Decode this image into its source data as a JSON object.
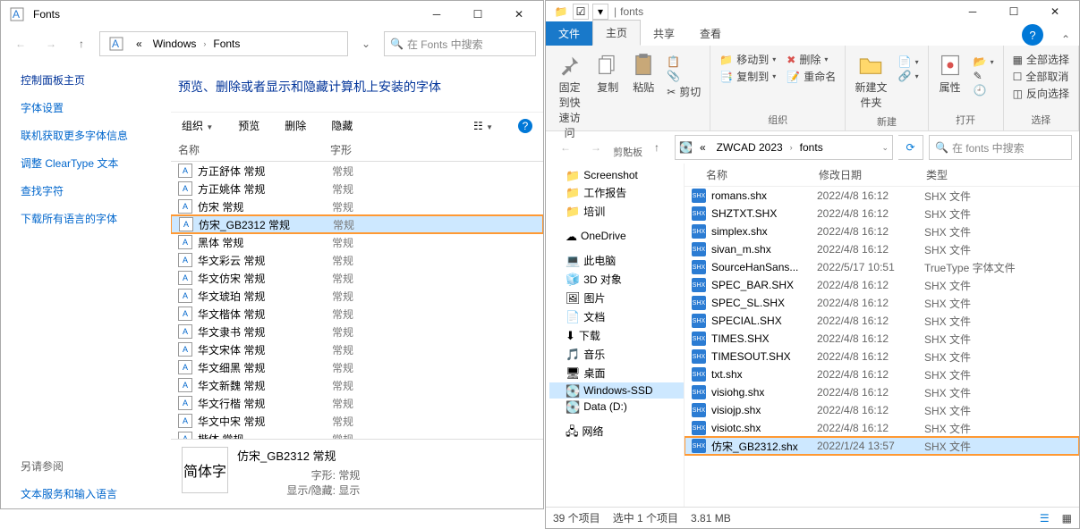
{
  "left": {
    "title": "Fonts",
    "breadcrumbs": [
      "Windows",
      "Fonts"
    ],
    "search_placeholder": "在 Fonts 中搜索",
    "sidebar": {
      "header": "控制面板主页",
      "links": [
        "字体设置",
        "联机获取更多字体信息",
        "调整 ClearType 文本",
        "查找字符",
        "下载所有语言的字体"
      ],
      "see_also": "另请参阅",
      "see_link": "文本服务和输入语言"
    },
    "header_text": "预览、删除或者显示和隐藏计算机上安装的字体",
    "toolbar": {
      "org": "组织",
      "prev": "预览",
      "del": "删除",
      "hide": "隐藏"
    },
    "cols": {
      "name": "名称",
      "style": "字形"
    },
    "items": [
      {
        "n": "方正舒体 常规",
        "s": "常规"
      },
      {
        "n": "方正姚体 常规",
        "s": "常规"
      },
      {
        "n": "仿宋 常规",
        "s": "常规"
      },
      {
        "n": "仿宋_GB2312 常规",
        "s": "常规",
        "sel": true,
        "frame": true
      },
      {
        "n": "黑体 常规",
        "s": "常规"
      },
      {
        "n": "华文彩云 常规",
        "s": "常规"
      },
      {
        "n": "华文仿宋 常规",
        "s": "常规"
      },
      {
        "n": "华文琥珀 常规",
        "s": "常规"
      },
      {
        "n": "华文楷体 常规",
        "s": "常规"
      },
      {
        "n": "华文隶书 常规",
        "s": "常规"
      },
      {
        "n": "华文宋体 常规",
        "s": "常规"
      },
      {
        "n": "华文细黑 常规",
        "s": "常规"
      },
      {
        "n": "华文新魏 常规",
        "s": "常规"
      },
      {
        "n": "华文行楷 常规",
        "s": "常规"
      },
      {
        "n": "华文中宋 常规",
        "s": "常规"
      },
      {
        "n": "楷体 常规",
        "s": "常规"
      }
    ],
    "detail": {
      "name": "仿宋_GB2312 常规",
      "style_label": "字形:",
      "style_val": "常规",
      "show_label": "显示/隐藏:",
      "show_val": "显示",
      "preview": "简体字"
    }
  },
  "right": {
    "title": "fonts",
    "tabs": {
      "file": "文件",
      "home": "主页",
      "share": "共享",
      "view": "查看"
    },
    "ribbon": {
      "pin": "固定到快速访问",
      "copy": "复制",
      "paste": "粘贴",
      "cut": "剪切",
      "clip_grp": "剪贴板",
      "move": "移动到",
      "copyto": "复制到",
      "del": "删除",
      "rename": "重命名",
      "org_grp": "组织",
      "newfolder": "新建文件夹",
      "new_grp": "新建",
      "props": "属性",
      "open_grp": "打开",
      "selall": "全部选择",
      "selnone": "全部取消",
      "selinv": "反向选择",
      "sel_grp": "选择"
    },
    "breadcrumbs": [
      "ZWCAD 2023",
      "fonts"
    ],
    "search_placeholder": "在 fonts 中搜索",
    "tree": [
      {
        "n": "Screenshot",
        "i": "📁"
      },
      {
        "n": "工作报告",
        "i": "📁"
      },
      {
        "n": "培训",
        "i": "📁"
      },
      {
        "n": "OneDrive",
        "i": "☁",
        "gap": true
      },
      {
        "n": "此电脑",
        "i": "💻",
        "gap": true
      },
      {
        "n": "3D 对象",
        "i": "🧊"
      },
      {
        "n": "图片",
        "i": "🖼"
      },
      {
        "n": "文档",
        "i": "📄"
      },
      {
        "n": "下载",
        "i": "⬇"
      },
      {
        "n": "音乐",
        "i": "🎵"
      },
      {
        "n": "桌面",
        "i": "🖥"
      },
      {
        "n": "Windows-SSD",
        "i": "💽",
        "sel": true
      },
      {
        "n": "Data (D:)",
        "i": "💽"
      },
      {
        "n": "网络",
        "i": "🖧",
        "gap": true
      }
    ],
    "cols": {
      "name": "名称",
      "date": "修改日期",
      "type": "类型"
    },
    "files": [
      {
        "n": "romans.shx",
        "d": "2022/4/8 16:12",
        "t": "SHX 文件"
      },
      {
        "n": "SHZTXT.SHX",
        "d": "2022/4/8 16:12",
        "t": "SHX 文件"
      },
      {
        "n": "simplex.shx",
        "d": "2022/4/8 16:12",
        "t": "SHX 文件"
      },
      {
        "n": "sivan_m.shx",
        "d": "2022/4/8 16:12",
        "t": "SHX 文件"
      },
      {
        "n": "SourceHanSans...",
        "d": "2022/5/17 10:51",
        "t": "TrueType 字体文件"
      },
      {
        "n": "SPEC_BAR.SHX",
        "d": "2022/4/8 16:12",
        "t": "SHX 文件"
      },
      {
        "n": "SPEC_SL.SHX",
        "d": "2022/4/8 16:12",
        "t": "SHX 文件"
      },
      {
        "n": "SPECIAL.SHX",
        "d": "2022/4/8 16:12",
        "t": "SHX 文件"
      },
      {
        "n": "TIMES.SHX",
        "d": "2022/4/8 16:12",
        "t": "SHX 文件"
      },
      {
        "n": "TIMESOUT.SHX",
        "d": "2022/4/8 16:12",
        "t": "SHX 文件"
      },
      {
        "n": "txt.shx",
        "d": "2022/4/8 16:12",
        "t": "SHX 文件"
      },
      {
        "n": "visiohg.shx",
        "d": "2022/4/8 16:12",
        "t": "SHX 文件"
      },
      {
        "n": "visiojp.shx",
        "d": "2022/4/8 16:12",
        "t": "SHX 文件"
      },
      {
        "n": "visiotc.shx",
        "d": "2022/4/8 16:12",
        "t": "SHX 文件"
      },
      {
        "n": "仿宋_GB2312.shx",
        "d": "2022/1/24 13:57",
        "t": "SHX 文件",
        "sel": true,
        "frame": true
      }
    ],
    "status": {
      "count": "39 个项目",
      "sel": "选中 1 个项目",
      "size": "3.81 MB"
    }
  }
}
